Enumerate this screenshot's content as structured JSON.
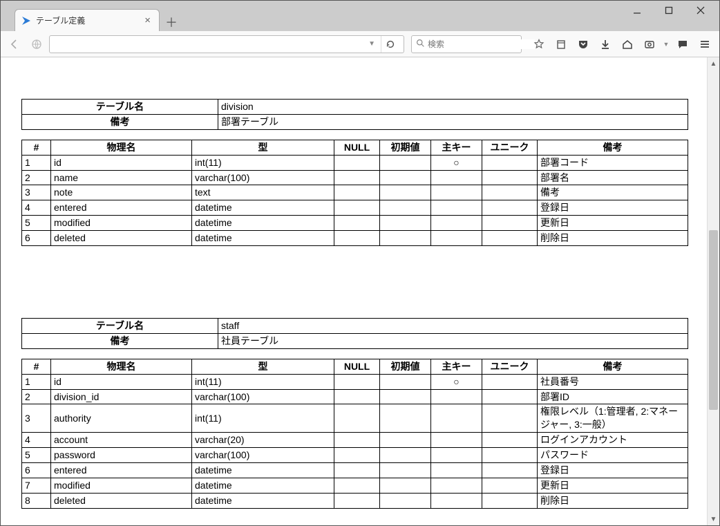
{
  "window": {
    "tab_title": "テーブル定義",
    "new_tab": "＋"
  },
  "nav": {
    "url": "",
    "search_placeholder": "検索"
  },
  "labels": {
    "table_name": "テーブル名",
    "remarks": "備考"
  },
  "col_headers": {
    "num": "#",
    "phys": "物理名",
    "type": "型",
    "null": "NULL",
    "default": "初期値",
    "pk": "主キー",
    "unique": "ユニーク",
    "note": "備考"
  },
  "tables": [
    {
      "name": "division",
      "remarks": "部署テーブル",
      "columns": [
        {
          "n": "1",
          "phys": "id",
          "type": "int(11)",
          "null": "",
          "def": "",
          "pk": "○",
          "uniq": "",
          "note": "部署コード"
        },
        {
          "n": "2",
          "phys": "name",
          "type": "varchar(100)",
          "null": "",
          "def": "",
          "pk": "",
          "uniq": "",
          "note": "部署名"
        },
        {
          "n": "3",
          "phys": "note",
          "type": "text",
          "null": "",
          "def": "",
          "pk": "",
          "uniq": "",
          "note": "備考"
        },
        {
          "n": "4",
          "phys": "entered",
          "type": "datetime",
          "null": "",
          "def": "",
          "pk": "",
          "uniq": "",
          "note": "登録日"
        },
        {
          "n": "5",
          "phys": "modified",
          "type": "datetime",
          "null": "",
          "def": "",
          "pk": "",
          "uniq": "",
          "note": "更新日"
        },
        {
          "n": "6",
          "phys": "deleted",
          "type": "datetime",
          "null": "",
          "def": "",
          "pk": "",
          "uniq": "",
          "note": "削除日"
        }
      ]
    },
    {
      "name": "staff",
      "remarks": "社員テーブル",
      "columns": [
        {
          "n": "1",
          "phys": "id",
          "type": "int(11)",
          "null": "",
          "def": "",
          "pk": "○",
          "uniq": "",
          "note": "社員番号"
        },
        {
          "n": "2",
          "phys": "division_id",
          "type": "varchar(100)",
          "null": "",
          "def": "",
          "pk": "",
          "uniq": "",
          "note": "部署ID"
        },
        {
          "n": "3",
          "phys": "authority",
          "type": "int(11)",
          "null": "",
          "def": "",
          "pk": "",
          "uniq": "",
          "note": "権限レベル（1:管理者, 2:マネージャー, 3:一般）"
        },
        {
          "n": "4",
          "phys": "account",
          "type": "varchar(20)",
          "null": "",
          "def": "",
          "pk": "",
          "uniq": "",
          "note": "ログインアカウント"
        },
        {
          "n": "5",
          "phys": "password",
          "type": "varchar(100)",
          "null": "",
          "def": "",
          "pk": "",
          "uniq": "",
          "note": "パスワード"
        },
        {
          "n": "6",
          "phys": "entered",
          "type": "datetime",
          "null": "",
          "def": "",
          "pk": "",
          "uniq": "",
          "note": "登録日"
        },
        {
          "n": "7",
          "phys": "modified",
          "type": "datetime",
          "null": "",
          "def": "",
          "pk": "",
          "uniq": "",
          "note": "更新日"
        },
        {
          "n": "8",
          "phys": "deleted",
          "type": "datetime",
          "null": "",
          "def": "",
          "pk": "",
          "uniq": "",
          "note": "削除日"
        }
      ]
    }
  ]
}
